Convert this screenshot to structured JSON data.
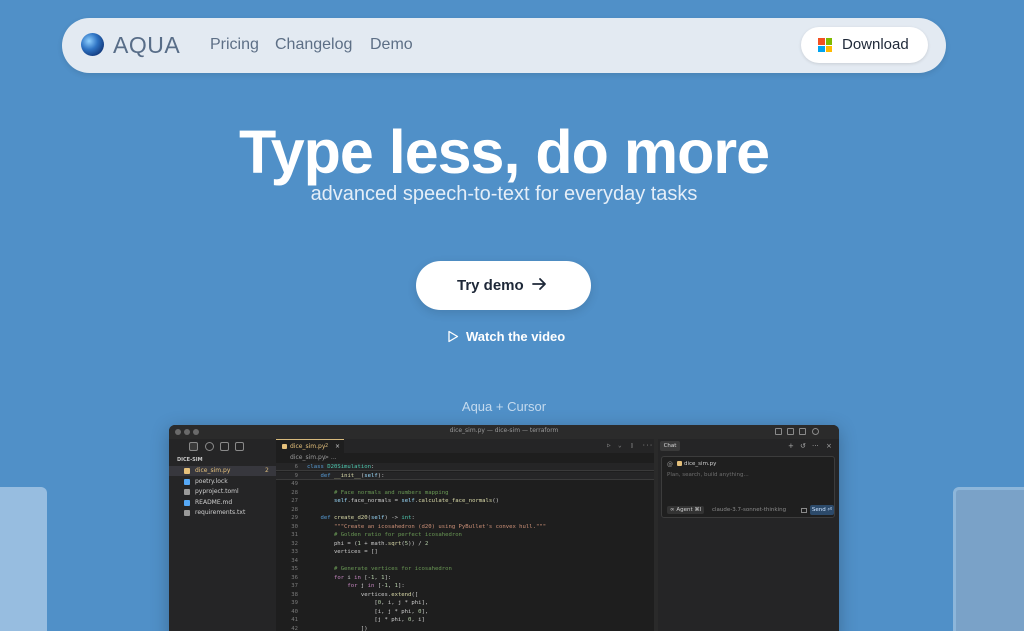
{
  "brand": {
    "name": "AQUA"
  },
  "nav": {
    "links": [
      "Pricing",
      "Changelog",
      "Demo"
    ],
    "download_label": "Download"
  },
  "colors": {
    "background": "#5090c8",
    "nav_background": "#e3eaf2",
    "windows_logo": [
      "#f25022",
      "#7fba00",
      "#00a4ef",
      "#ffb900"
    ]
  },
  "hero": {
    "title": "Type less, do more",
    "subtitle": "advanced speech-to-text for everyday tasks",
    "cta_label": "Try demo",
    "watch_label": "Watch the video",
    "caption": "Aqua + Cursor"
  },
  "editor": {
    "window_title": "dice_sim.py — dice-sim — terraform",
    "explorer": {
      "header": "DICE-SIM",
      "files": [
        {
          "name": "dice_sim.py",
          "badge": "2",
          "active": true,
          "icon_color": "#e5c07b"
        },
        {
          "name": "poetry.lock",
          "badge": "",
          "active": false,
          "icon_color": "#56a8f5"
        },
        {
          "name": "pyproject.toml",
          "badge": "",
          "active": false,
          "icon_color": "#9a9a9a"
        },
        {
          "name": "README.md",
          "badge": "",
          "active": false,
          "icon_color": "#56a8f5"
        },
        {
          "name": "requirements.txt",
          "badge": "",
          "active": false,
          "icon_color": "#9a9a9a"
        }
      ]
    },
    "tab": {
      "label": "dice_sim.py",
      "modified": "2"
    },
    "breadcrumb": {
      "file": "dice_sim.py",
      "sep": "> ..."
    },
    "code_lines": [
      {
        "n": "6",
        "html": "<span class='kw'>class</span> <span class='cls'>D20Simulation</span>:",
        "sticky": true
      },
      {
        "n": "9",
        "html": "    <span class='kw'>def</span> <span class='fn2'>__init__</span>(<span class='sf'>self</span>):",
        "sticky": true
      },
      {
        "n": "49",
        "html": "",
        "sticky": false
      },
      {
        "n": "28",
        "html": "        <span class='cm'># Face normals and numbers mapping</span>",
        "sticky": false
      },
      {
        "n": "27",
        "html": "        <span class='sf'>self</span>.face_normals = <span class='sf'>self</span>.<span class='fn2'>calculate_face_normals</span>()",
        "sticky": false
      },
      {
        "n": "28",
        "html": "",
        "sticky": false
      },
      {
        "n": "29",
        "html": "    <span class='kw'>def</span> <span class='fn2'>create_d20</span>(<span class='sf'>self</span>) -> <span class='cls'>int</span>:",
        "sticky": false
      },
      {
        "n": "30",
        "html": "        <span class='st'>\"\"\"Create an icosahedron (d20) using PyBullet's convex hull.\"\"\"</span>",
        "sticky": false
      },
      {
        "n": "31",
        "html": "        <span class='cm'># Golden ratio for perfect icosahedron</span>",
        "sticky": false
      },
      {
        "n": "32",
        "html": "        phi = (<span class='nm'>1</span> + math.<span class='fn2'>sqrt</span>(<span class='nm'>5</span>)) / <span class='nm'>2</span>",
        "sticky": false
      },
      {
        "n": "33",
        "html": "        vertices = []",
        "sticky": false
      },
      {
        "n": "34",
        "html": "",
        "sticky": false
      },
      {
        "n": "35",
        "html": "        <span class='cm'># Generate vertices for icosahedron</span>",
        "sticky": false
      },
      {
        "n": "36",
        "html": "        <span class='ctrl'>for</span> i <span class='ctrl'>in</span> [-<span class='nm'>1</span>, <span class='nm'>1</span>]:",
        "sticky": false
      },
      {
        "n": "37",
        "html": "            <span class='ctrl'>for</span> j <span class='ctrl'>in</span> [-<span class='nm'>1</span>, <span class='nm'>1</span>]:",
        "sticky": false
      },
      {
        "n": "38",
        "html": "                vertices.<span class='fn2'>extend</span>([",
        "sticky": false
      },
      {
        "n": "39",
        "html": "                    [<span class='nm'>0</span>, i, j * phi],",
        "sticky": false
      },
      {
        "n": "40",
        "html": "                    [i, j * phi, <span class='nm'>0</span>],",
        "sticky": false
      },
      {
        "n": "41",
        "html": "                    [j * phi, <span class='nm'>0</span>, i]",
        "sticky": false
      },
      {
        "n": "42",
        "html": "                ])",
        "sticky": false
      }
    ],
    "chat": {
      "tab_label": "Chat",
      "context_chip": "dice_sim.py",
      "placeholder": "Plan, search, build anything...",
      "agent_label": "∞ Agent ⌘I",
      "model_label": "claude-3.7-sonnet-thinking",
      "send_label": "Send ⏎"
    }
  }
}
